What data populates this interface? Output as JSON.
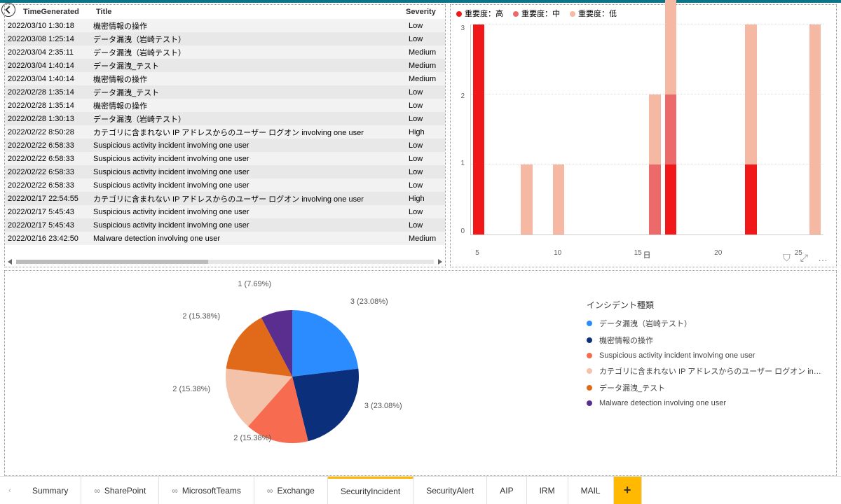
{
  "colors": {
    "sev_high": "#f01818",
    "sev_med": "#ed6a6a",
    "sev_low": "#f4b8a3",
    "pie": [
      "#2b8cff",
      "#0b2f7a",
      "#f76c50",
      "#f4c2a8",
      "#e06a1a",
      "#5a2e8e"
    ]
  },
  "back_label": "Back",
  "table": {
    "headers": {
      "time": "TimeGenerated",
      "title": "Title",
      "severity": "Severity"
    },
    "rows": [
      {
        "time": "2022/03/10 1:30:18",
        "title": "機密情報の操作",
        "sev": "Low"
      },
      {
        "time": "2022/03/08 1:25:14",
        "title": "データ漏洩（岩崎テスト）",
        "sev": "Low"
      },
      {
        "time": "2022/03/04 2:35:11",
        "title": "データ漏洩（岩崎テスト）",
        "sev": "Medium"
      },
      {
        "time": "2022/03/04 1:40:14",
        "title": "データ漏洩_テスト",
        "sev": "Medium"
      },
      {
        "time": "2022/03/04 1:40:14",
        "title": "機密情報の操作",
        "sev": "Medium"
      },
      {
        "time": "2022/02/28 1:35:14",
        "title": "データ漏洩_テスト",
        "sev": "Low"
      },
      {
        "time": "2022/02/28 1:35:14",
        "title": "機密情報の操作",
        "sev": "Low"
      },
      {
        "time": "2022/02/28 1:30:13",
        "title": "データ漏洩（岩崎テスト）",
        "sev": "Low"
      },
      {
        "time": "2022/02/22 8:50:28",
        "title": "カテゴリに含まれない IP アドレスからのユーザー ログオン involving one user",
        "sev": "High"
      },
      {
        "time": "2022/02/22 6:58:33",
        "title": "Suspicious activity incident involving one user",
        "sev": "Low"
      },
      {
        "time": "2022/02/22 6:58:33",
        "title": "Suspicious activity incident involving one user",
        "sev": "Low"
      },
      {
        "time": "2022/02/22 6:58:33",
        "title": "Suspicious activity incident involving one user",
        "sev": "Low"
      },
      {
        "time": "2022/02/22 6:58:33",
        "title": "Suspicious activity incident involving one user",
        "sev": "Low"
      },
      {
        "time": "2022/02/17 22:54:55",
        "title": "カテゴリに含まれない IP アドレスからのユーザー ログオン involving one user",
        "sev": "High"
      },
      {
        "time": "2022/02/17 5:45:43",
        "title": "Suspicious activity incident involving one user",
        "sev": "Low"
      },
      {
        "time": "2022/02/17 5:45:43",
        "title": "Suspicious activity incident involving one user",
        "sev": "Low"
      },
      {
        "time": "2022/02/16 23:42:50",
        "title": "Malware detection involving one user",
        "sev": "Medium"
      }
    ]
  },
  "chart_data": [
    {
      "type": "bar",
      "title": "",
      "xlabel": "日",
      "ylabel": "",
      "ylim": [
        0,
        3
      ],
      "yticks": [
        0,
        1,
        2,
        3
      ],
      "categories": [
        5,
        6,
        7,
        8,
        9,
        10,
        11,
        12,
        13,
        14,
        15,
        16,
        17,
        18,
        19,
        20,
        21,
        22,
        23,
        24,
        25,
        26
      ],
      "series": [
        {
          "name": "重要度：高",
          "color": "#f01818",
          "values": [
            3,
            0,
            0,
            0,
            0,
            0,
            0,
            0,
            0,
            0,
            0,
            0,
            1,
            0,
            0,
            0,
            0,
            1,
            0,
            0,
            0,
            0
          ]
        },
        {
          "name": "重要度：中",
          "color": "#ed6a6a",
          "values": [
            0,
            0,
            0,
            0,
            0,
            0,
            0,
            0,
            0,
            0,
            0,
            1,
            1,
            0,
            0,
            0,
            0,
            0,
            0,
            0,
            0,
            0
          ]
        },
        {
          "name": "重要度：低",
          "color": "#f4b8a3",
          "values": [
            0,
            0,
            0,
            1,
            0,
            1,
            0,
            0,
            0,
            0,
            0,
            1,
            2,
            0,
            0,
            0,
            0,
            2,
            0,
            0,
            0,
            3
          ]
        }
      ],
      "x_ticks": [
        5,
        10,
        15,
        20,
        25
      ]
    },
    {
      "type": "pie",
      "title": "インシデント種類",
      "series": [
        {
          "name": "データ漏洩（岩崎テスト）",
          "value": 3,
          "pct": "23.08%",
          "color": "#2b8cff"
        },
        {
          "name": "機密情報の操作",
          "value": 3,
          "pct": "23.08%",
          "color": "#0b2f7a"
        },
        {
          "name": "Suspicious activity incident involving one user",
          "value": 2,
          "pct": "15.38%",
          "color": "#f76c50"
        },
        {
          "name": "カテゴリに含まれない IP アドレスからのユーザー ログオン in…",
          "value": 2,
          "pct": "15.38%",
          "color": "#f4c2a8"
        },
        {
          "name": "データ漏洩_テスト",
          "value": 2,
          "pct": "15.38%",
          "color": "#e06a1a"
        },
        {
          "name": "Malware detection involving one user",
          "value": 1,
          "pct": "7.69%",
          "color": "#5a2e8e"
        }
      ]
    }
  ],
  "bar_legend": [
    {
      "label": "重要度：高",
      "color": "#f01818"
    },
    {
      "label": "重要度：中",
      "color": "#ed6a6a"
    },
    {
      "label": "重要度：低",
      "color": "#f4b8a3"
    }
  ],
  "toolbar_icons": {
    "filter": "⛉",
    "focus": "⤢",
    "more": "…"
  },
  "tabs": {
    "scroll_left": "‹",
    "scroll_right": "›",
    "items": [
      {
        "label": "Summary",
        "linked": false
      },
      {
        "label": "SharePoint",
        "linked": true
      },
      {
        "label": "MicrosoftTeams",
        "linked": true
      },
      {
        "label": "Exchange",
        "linked": true
      },
      {
        "label": "SecurityIncident",
        "linked": false,
        "active": true
      },
      {
        "label": "SecurityAlert",
        "linked": false
      },
      {
        "label": "AIP",
        "linked": false
      },
      {
        "label": "IRM",
        "linked": false
      },
      {
        "label": "MAIL",
        "linked": false
      }
    ],
    "add": "+"
  }
}
